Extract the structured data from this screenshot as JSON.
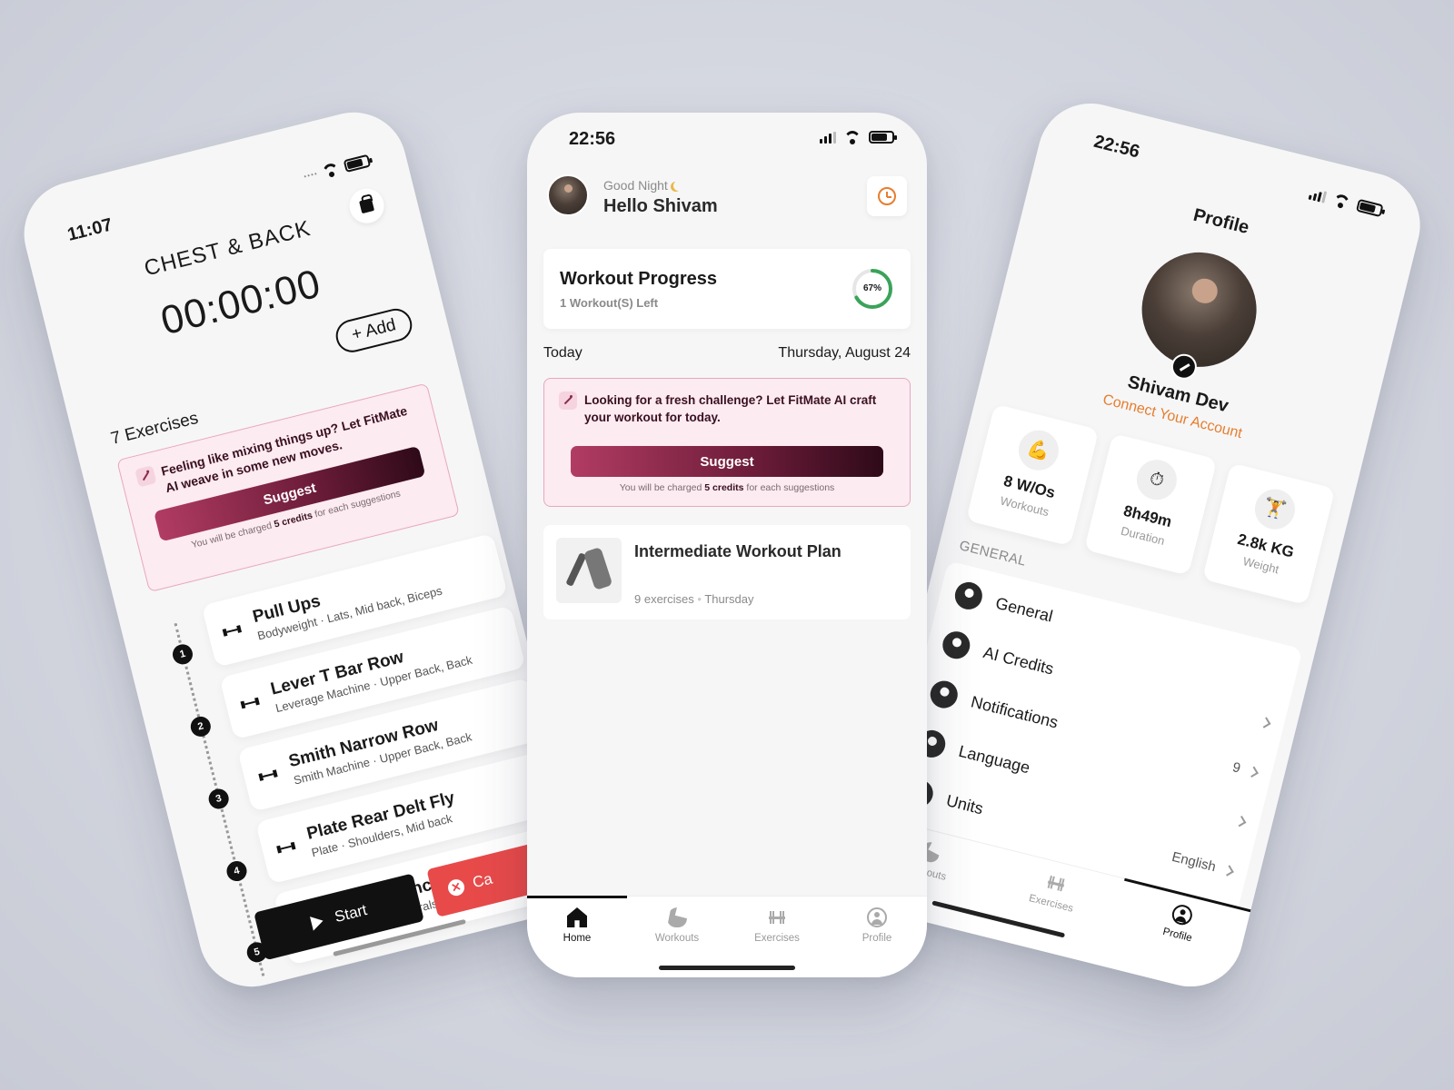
{
  "left": {
    "time": "11:07",
    "title": "CHEST & BACK",
    "timer": "00:00:00",
    "add_label": "+ Add",
    "exercise_count": "7 Exercises",
    "ai": {
      "message": "Feeling like mixing things up? Let FitMate AI weave in some new moves.",
      "suggest_label": "Suggest",
      "charge_pre": "You will be charged ",
      "charge_credits": "5 credits",
      "charge_post": " for each suggestions"
    },
    "exercises": [
      {
        "step": "1",
        "name": "Pull Ups",
        "meta": "Bodyweight · Lats, Mid back, Biceps"
      },
      {
        "step": "2",
        "name": "Lever T Bar Row",
        "meta": "Leverage Machine · Upper Back, Back"
      },
      {
        "step": "3",
        "name": "Smith Narrow Row",
        "meta": "Smith Machine · Upper Back, Back"
      },
      {
        "step": "4",
        "name": "Plate Rear Delt Fly",
        "meta": "Plate · Shoulders, Mid back"
      },
      {
        "step": "5",
        "name": "Dumbbell Incline Bench Press",
        "meta": "Dumbbell · Pectorals, Chest"
      }
    ],
    "start_label": "Start",
    "cancel_label": "Ca"
  },
  "center": {
    "time": "22:56",
    "battery": "57",
    "greeting": "Good Night",
    "name": "Hello Shivam",
    "progress": {
      "title": "Workout Progress",
      "subtitle": "1 Workout(S) Left",
      "percent": 67,
      "percent_label": "67%"
    },
    "today_label": "Today",
    "date": "Thursday, August 24",
    "ai": {
      "message": "Looking for a fresh challenge? Let FitMate AI craft your workout for today.",
      "suggest_label": "Suggest",
      "charge_pre": "You will be charged ",
      "charge_credits": "5 credits",
      "charge_post": " for each suggestions"
    },
    "plan": {
      "title": "Intermediate Workout Plan",
      "exercises": "9 exercises",
      "day": "Thursday"
    },
    "tabs": [
      {
        "label": "Home"
      },
      {
        "label": "Workouts"
      },
      {
        "label": "Exercises"
      },
      {
        "label": "Profile"
      }
    ]
  },
  "right": {
    "time": "22:56",
    "battery": "57",
    "title": "Profile",
    "user_name": "Shivam Dev",
    "connect": "Connect Your Account",
    "stats": [
      {
        "value": "8 W/Os",
        "label": "Workouts",
        "icon": "💪"
      },
      {
        "value": "8h49m",
        "label": "Duration",
        "icon": "⏱"
      },
      {
        "value": "2.8k KG",
        "label": "Weight",
        "icon": "🏋"
      }
    ],
    "section": "GENERAL",
    "settings": [
      {
        "label": "General",
        "value": ""
      },
      {
        "label": "AI Credits",
        "value": ""
      },
      {
        "label": "Notifications",
        "value": "9"
      },
      {
        "label": "Language",
        "value": ""
      },
      {
        "label": "Units",
        "value": "English"
      }
    ],
    "tabs": [
      {
        "label": "Workouts"
      },
      {
        "label": "Exercises"
      },
      {
        "label": "Profile"
      }
    ]
  },
  "colors": {
    "accent_orange": "#e67e2e",
    "ai_gradient_start": "#b23c63",
    "ai_gradient_end": "#2e0a18",
    "cancel_red": "#e84a4a",
    "progress_green": "#3aa35a"
  }
}
